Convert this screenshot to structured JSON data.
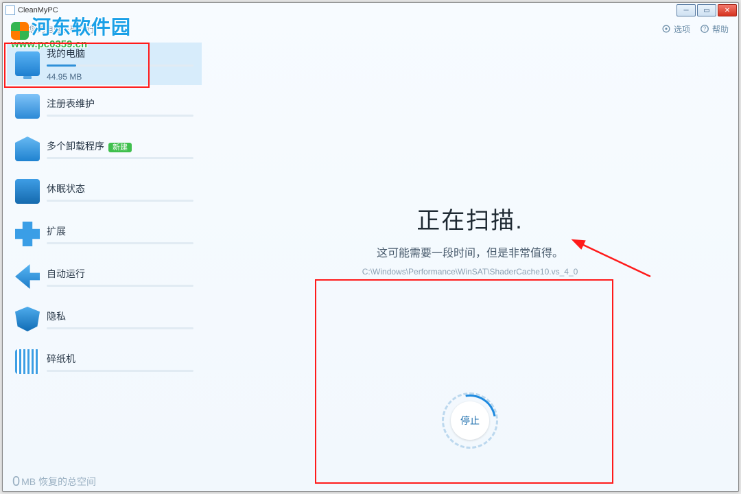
{
  "window": {
    "title": "CleanMyPC"
  },
  "header": {
    "tagline": "保持您的电脑正确运行",
    "options": "选项",
    "help": "帮助"
  },
  "sidebar": {
    "items": [
      {
        "label": "我的电脑",
        "sub": "44.95 MB"
      },
      {
        "label": "注册表维护"
      },
      {
        "label": "多个卸载程序",
        "badge": "新建"
      },
      {
        "label": "休眠状态"
      },
      {
        "label": "扩展"
      },
      {
        "label": "自动运行"
      },
      {
        "label": "隐私"
      },
      {
        "label": "碎纸机"
      }
    ]
  },
  "main": {
    "title": "正在扫描.",
    "subtitle": "这可能需要一段时间，但是非常值得。",
    "path": "C:\\Windows\\Performance\\WinSAT\\ShaderCache10.vs_4_0",
    "stop": "停止"
  },
  "footer": {
    "value": "0",
    "unit": "MB",
    "label": "恢复的总空间"
  },
  "watermark": {
    "cn": "河东软件园",
    "url": "www.pc0359.cn"
  }
}
